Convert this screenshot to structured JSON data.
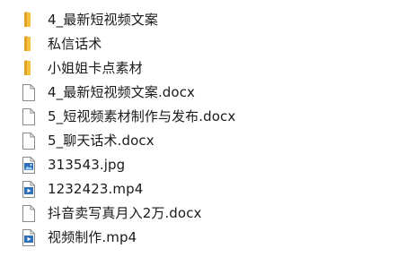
{
  "items": [
    {
      "name": "4_最新短视频文案",
      "type": "folder",
      "icon": "folder-icon"
    },
    {
      "name": "私信话术",
      "type": "folder",
      "icon": "folder-icon"
    },
    {
      "name": "小姐姐卡点素材",
      "type": "folder",
      "icon": "folder-icon"
    },
    {
      "name": "4_最新短视频文案.docx",
      "type": "document",
      "icon": "document-icon"
    },
    {
      "name": "5_短视频素材制作与发布.docx",
      "type": "document",
      "icon": "document-icon"
    },
    {
      "name": "5_聊天话术.docx",
      "type": "document",
      "icon": "document-icon"
    },
    {
      "name": "313543.jpg",
      "type": "image",
      "icon": "image-file-icon"
    },
    {
      "name": "1232423.mp4",
      "type": "video",
      "icon": "video-file-icon"
    },
    {
      "name": "抖音卖写真月入2万.docx",
      "type": "document",
      "icon": "document-icon"
    },
    {
      "name": "视频制作.mp4",
      "type": "video",
      "icon": "video-file-icon"
    }
  ],
  "colors": {
    "folder_body": "#f5c240",
    "folder_tab": "#e0a526",
    "page_border": "#8a8a8a",
    "media_accent": "#2d6fb8"
  }
}
